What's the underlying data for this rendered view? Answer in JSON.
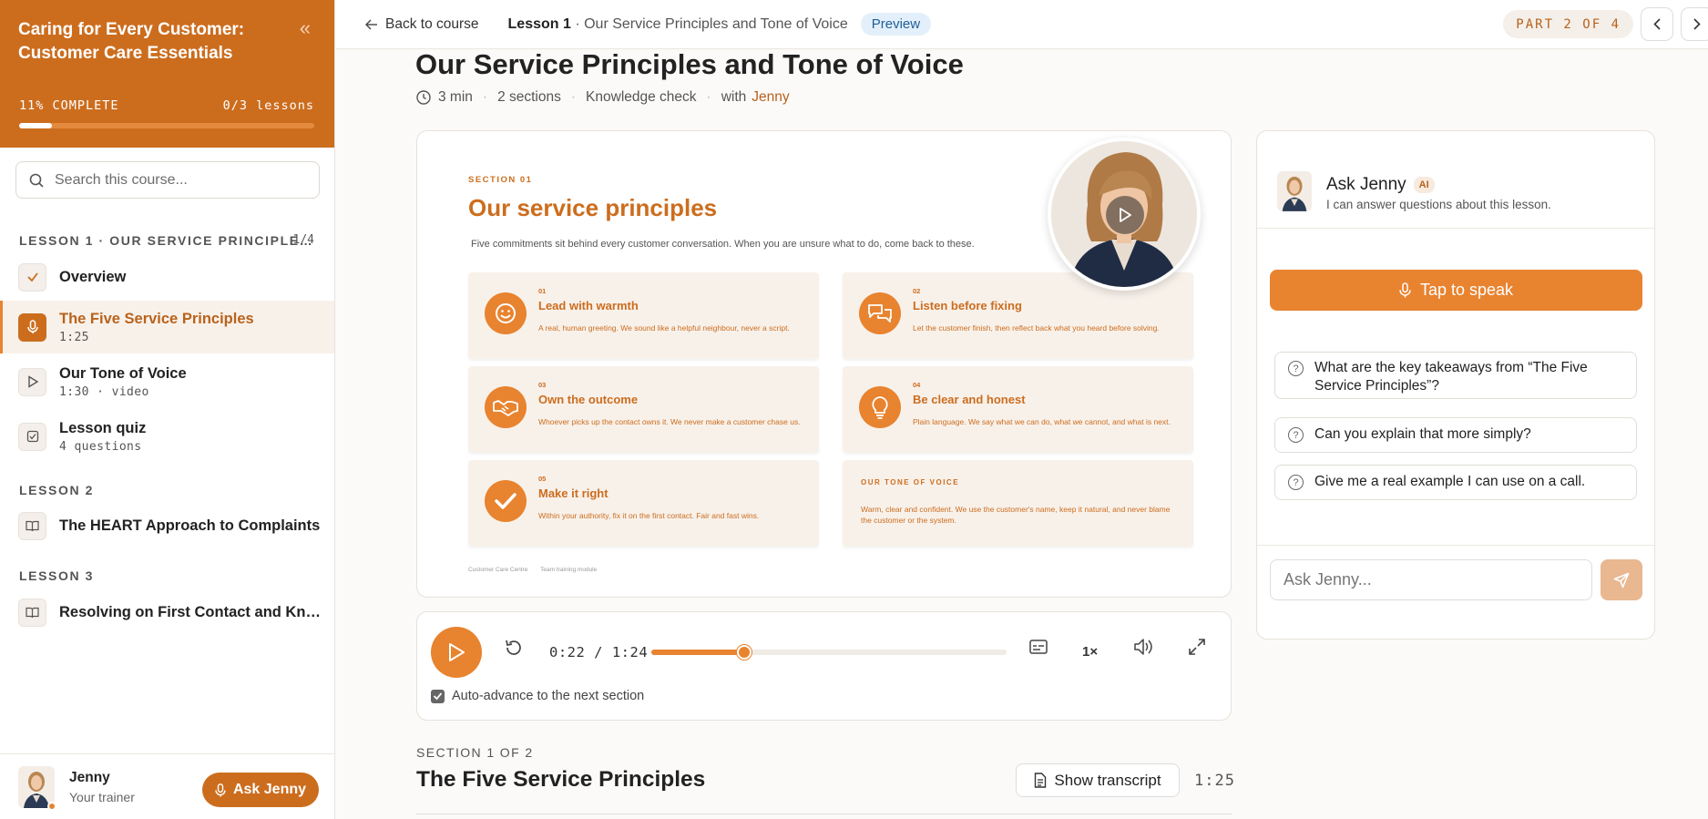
{
  "sidebar": {
    "course_title": "Caring for Every Customer: Customer Care Essentials",
    "progress_text": "11% COMPLETE",
    "progress_fraction": 0.11,
    "lessons_done": "0/3 lessons",
    "search_placeholder": "Search this course...",
    "lesson1_label": "LESSON 1 · OUR SERVICE PRINCIPLE…",
    "lesson1_count": "1/4",
    "lesson1_items": [
      {
        "name": "Overview",
        "sub": "",
        "icon": "check-icon"
      },
      {
        "name": "The Five Service Principles",
        "sub": "1:25",
        "icon": "mic-icon"
      },
      {
        "name": "Our Tone of Voice",
        "sub": "1:30 · video",
        "icon": "play-icon"
      },
      {
        "name": "Lesson quiz",
        "sub": "4 questions",
        "icon": "quiz-icon"
      }
    ],
    "lesson2_label": "LESSON 2",
    "lesson2_item": "The HEART Approach to Complaints",
    "lesson3_label": "LESSON 3",
    "lesson3_item": "Resolving on First Contact and Know…",
    "footer_name": "Jenny",
    "footer_role": "Your trainer",
    "ask_button": "Ask Jenny"
  },
  "topbar": {
    "back": "Back to course",
    "crumb_bold": "Lesson 1",
    "crumb_rest": " · Our Service Principles and Tone of Voice",
    "badge": "Preview",
    "part": "PART 2 OF 4"
  },
  "page": {
    "title": "Our Service Principles and Tone of Voice",
    "duration": "3 min",
    "sections": "2 sections",
    "check": "Knowledge check",
    "with": "with",
    "trainer": "Jenny"
  },
  "slide": {
    "tag": "SECTION 01",
    "title": "Our service principles",
    "intro": "Five commitments sit behind every customer conversation. When you are unsure what to do, come back to these.",
    "principles": [
      {
        "num": "01",
        "title": "Lead with warmth",
        "desc": "A real, human greeting. We sound like a helpful neighbour, never a script.",
        "icon": "smile-icon"
      },
      {
        "num": "02",
        "title": "Listen before fixing",
        "desc": "Let the customer finish, then reflect back what you heard before solving.",
        "icon": "chat-icon"
      },
      {
        "num": "03",
        "title": "Own the outcome",
        "desc": "Whoever picks up the contact owns it. We never make a customer chase us.",
        "icon": "handshake-icon"
      },
      {
        "num": "04",
        "title": "Be clear and honest",
        "desc": "Plain language. We say what we can do, what we cannot, and what is next.",
        "icon": "bulb-icon"
      },
      {
        "num": "05",
        "title": "Make it right",
        "desc": "Within your authority, fix it on the first contact. Fair and fast wins.",
        "icon": "check-icon"
      }
    ],
    "tone_label": "OUR TONE OF VOICE",
    "tone_desc": "Warm, clear and confident. We use the customer's name, keep it natural, and never blame the customer or the system.",
    "footer_left": "Customer Care Centre",
    "footer_right": "Team training module"
  },
  "player": {
    "time": "0:22 / 1:24",
    "progress_fraction": 0.262,
    "speed": "1×",
    "auto_advance": "Auto-advance to the next section"
  },
  "section": {
    "label": "SECTION 1 OF 2",
    "title": "The Five Service Principles",
    "transcript_button": "Show transcript",
    "duration": "1:25"
  },
  "assistant": {
    "name": "Ask Jenny",
    "badge": "AI",
    "subtitle": "I can answer questions about this lesson.",
    "tap": "Tap to speak",
    "suggestions": [
      "What are the key takeaways from “The Five Service Principles”?",
      "Can you explain that more simply?",
      "Give me a real example I can use on a call."
    ],
    "input_placeholder": "Ask Jenny..."
  },
  "colors": {
    "brand": "#cc6d1e",
    "accent": "#e8832f",
    "tint": "#f8f1ea"
  }
}
